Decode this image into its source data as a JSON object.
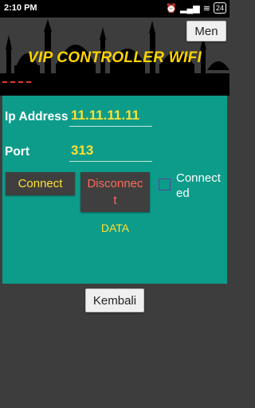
{
  "status_bar": {
    "time": "2:10 PM",
    "battery": "24"
  },
  "header": {
    "title": "VIP CONTROLLER WIFI",
    "menu_label": "Men"
  },
  "form": {
    "ip_label": "Ip Address",
    "ip_value": "11.11.11.11",
    "port_label": "Port",
    "port_value": "313"
  },
  "buttons": {
    "connect": "Connect",
    "disconnect": "Disconnect",
    "back": "Kembali"
  },
  "connected_checkbox": {
    "label": "Connected",
    "checked": false
  },
  "data_label": "DATA",
  "colors": {
    "panel": "#0d9c8a",
    "title": "#ffd400",
    "value": "#ffe033",
    "disconnect": "#ff6a5a"
  }
}
